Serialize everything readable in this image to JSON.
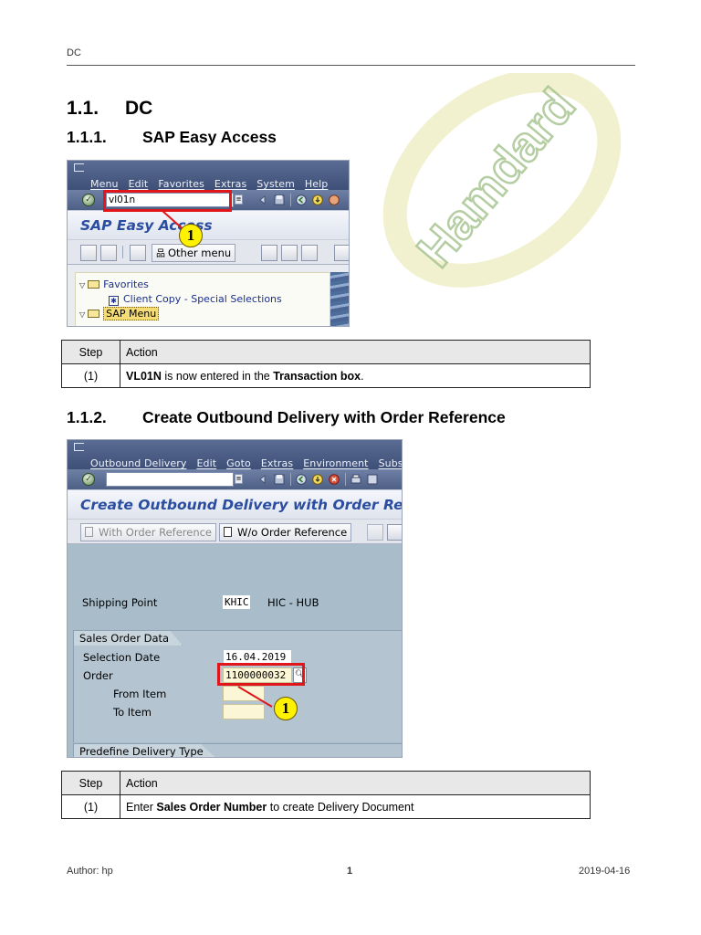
{
  "header": {
    "text": "DC"
  },
  "footer": {
    "author": "Author: hp",
    "page": "1",
    "date": "2019-04-16"
  },
  "watermark": {
    "text": "Hamdard",
    "color": "#9dbd84"
  },
  "h1": {
    "num": "1.1.",
    "title": "DC"
  },
  "sec1": {
    "num": "1.1.1.",
    "title": "SAP Easy Access",
    "screenshot": {
      "menu": [
        "Menu",
        "Edit",
        "Favorites",
        "Extras",
        "System",
        "Help"
      ],
      "command_value": "vl01n",
      "title": "SAP Easy Access",
      "other_menu": "Other menu",
      "tree": {
        "favorites": "Favorites",
        "client_copy": "Client Copy - Special Selections",
        "sap_menu": "SAP Menu"
      },
      "callout": "1"
    },
    "table": {
      "headers": [
        "Step",
        "Action"
      ],
      "row": {
        "step": "(1)",
        "bold1": "VL01N",
        "text1": " is now entered in the ",
        "bold2": "Transaction box",
        "text2": "."
      }
    }
  },
  "sec2": {
    "num": "1.1.2.",
    "title": "Create Outbound Delivery with Order Reference",
    "screenshot": {
      "menu": [
        "Outbound Delivery",
        "Edit",
        "Goto",
        "Extras",
        "Environment",
        "Subse"
      ],
      "command_value": "",
      "title": "Create Outbound Delivery with Order Refe",
      "btn_with_ref": "With Order Reference",
      "btn_wo_ref": "W/o Order Reference",
      "shipping_point_label": "Shipping Point",
      "shipping_point_value": "KHIC",
      "shipping_point_desc": "HIC - HUB",
      "group_title": "Sales Order Data",
      "selection_date_label": "Selection Date",
      "selection_date_value": "16.04.2019",
      "order_label": "Order",
      "order_value": "1100000032",
      "from_item_label": "From Item",
      "to_item_label": "To Item",
      "group2_title": "Predefine Delivery Type",
      "callout": "1"
    },
    "table": {
      "headers": [
        "Step",
        "Action"
      ],
      "row": {
        "step": "(1)",
        "text1": "Enter ",
        "bold1": "Sales Order Number",
        "text2": " to create Delivery Document"
      }
    }
  },
  "colors": {
    "sap_title_blue": "#2b4da0",
    "highlight_red": "#e0161b",
    "callout_yellow": "#fff200"
  }
}
